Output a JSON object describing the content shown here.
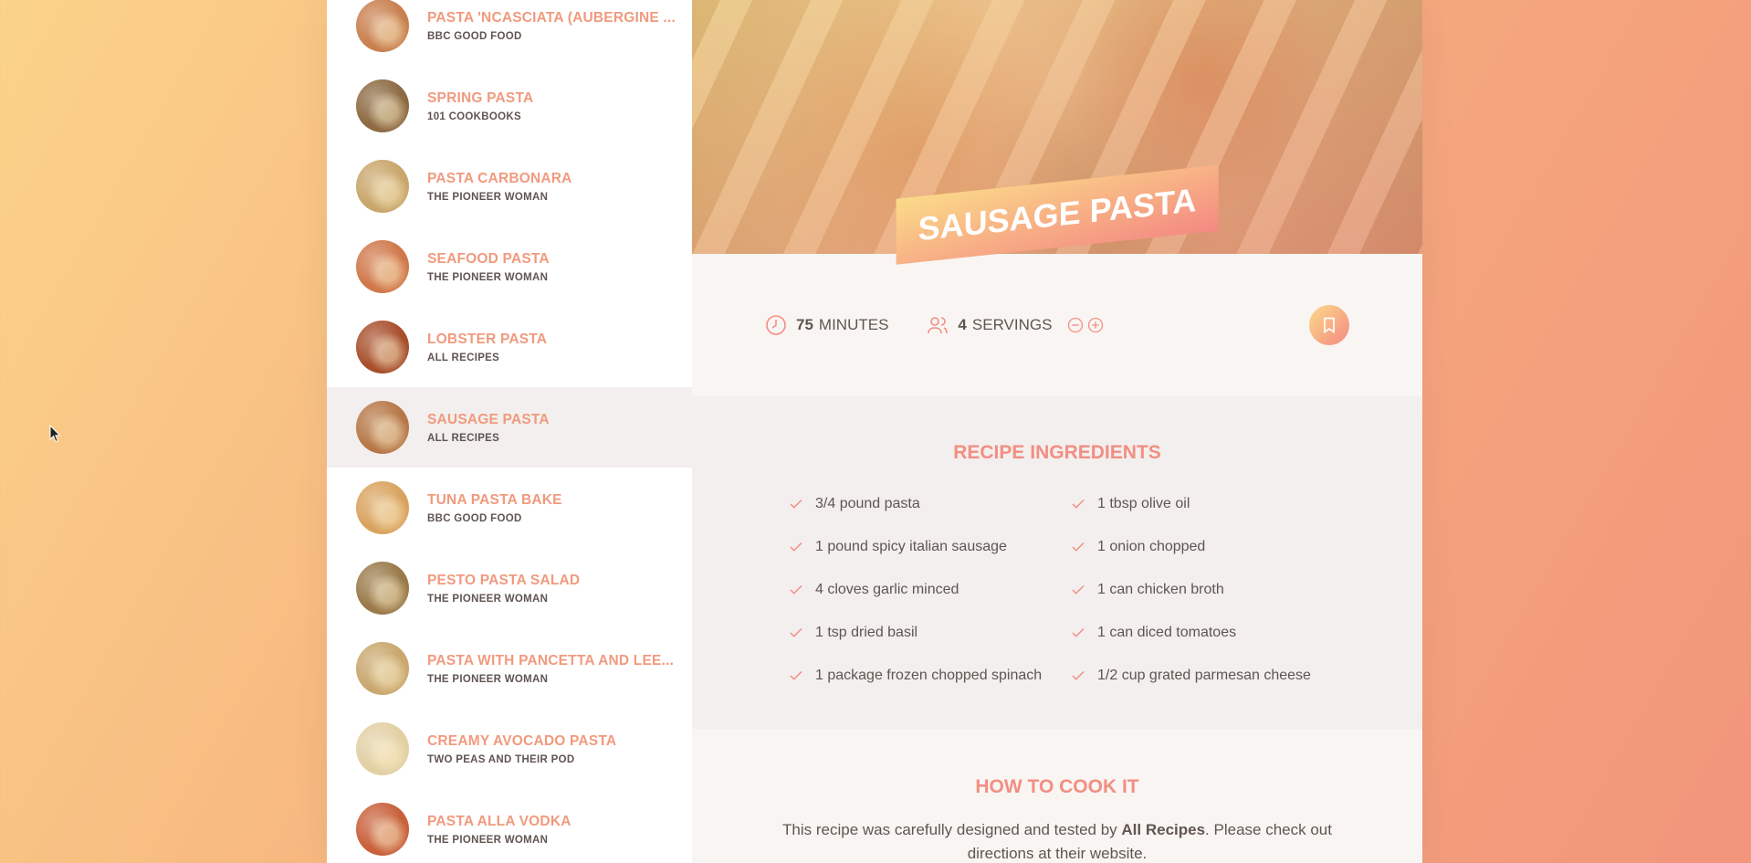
{
  "colors": {
    "accent": "#f38e82",
    "text": "#615551",
    "sidebar_bg": "#ffffff",
    "active_row": "#f2efee"
  },
  "sidebar": {
    "results": [
      {
        "title": "PASTA 'NCASCIATA (AUBERGINE ...",
        "publisher": "BBC GOOD FOOD",
        "active": false,
        "thumb": "#c9804f"
      },
      {
        "title": "SPRING PASTA",
        "publisher": "101 COOKBOOKS",
        "active": false,
        "thumb": "#8d6a43"
      },
      {
        "title": "PASTA CARBONARA",
        "publisher": "THE PIONEER WOMAN",
        "active": false,
        "thumb": "#c9a66b"
      },
      {
        "title": "SEAFOOD PASTA",
        "publisher": "THE PIONEER WOMAN",
        "active": false,
        "thumb": "#d0784a"
      },
      {
        "title": "LOBSTER PASTA",
        "publisher": "ALL RECIPES",
        "active": false,
        "thumb": "#a8502d"
      },
      {
        "title": "SAUSAGE PASTA",
        "publisher": "ALL RECIPES",
        "active": true,
        "thumb": "#b77848"
      },
      {
        "title": "TUNA PASTA BAKE",
        "publisher": "BBC GOOD FOOD",
        "active": false,
        "thumb": "#d9a35f"
      },
      {
        "title": "PESTO PASTA SALAD",
        "publisher": "THE PIONEER WOMAN",
        "active": false,
        "thumb": "#9a7a4a"
      },
      {
        "title": "PASTA WITH PANCETTA AND LEE...",
        "publisher": "THE PIONEER WOMAN",
        "active": false,
        "thumb": "#c9a76e"
      },
      {
        "title": "CREAMY AVOCADO PASTA",
        "publisher": "TWO PEAS AND THEIR POD",
        "active": false,
        "thumb": "#e2cfa4"
      },
      {
        "title": "PASTA ALLA VODKA",
        "publisher": "THE PIONEER WOMAN",
        "active": false,
        "thumb": "#c8603b"
      }
    ]
  },
  "recipe": {
    "title": "SAUSAGE PASTA",
    "cooking_time": "75",
    "cooking_unit": "MINUTES",
    "servings": "4",
    "servings_unit": "SERVINGS",
    "ingredients_heading": "RECIPE INGREDIENTS",
    "ingredients": [
      "3/4 pound pasta",
      "1 tbsp olive oil",
      "1 pound spicy italian sausage",
      "1 onion chopped",
      "4 cloves garlic minced",
      "1 can chicken broth",
      "1 tsp dried basil",
      "1 can diced tomatoes",
      "1 package frozen chopped spinach",
      "1/2 cup grated parmesan cheese"
    ],
    "directions_heading": "HOW TO COOK IT",
    "directions_pre": "This recipe was carefully designed and tested by ",
    "directions_publisher": "All Recipes",
    "directions_post": ". Please check out directions at their website."
  },
  "icons": {
    "clock": "clock-icon",
    "users": "users-icon",
    "minus": "minus-circle-icon",
    "plus": "plus-circle-icon",
    "bookmark": "bookmark-icon",
    "check": "check-icon"
  }
}
